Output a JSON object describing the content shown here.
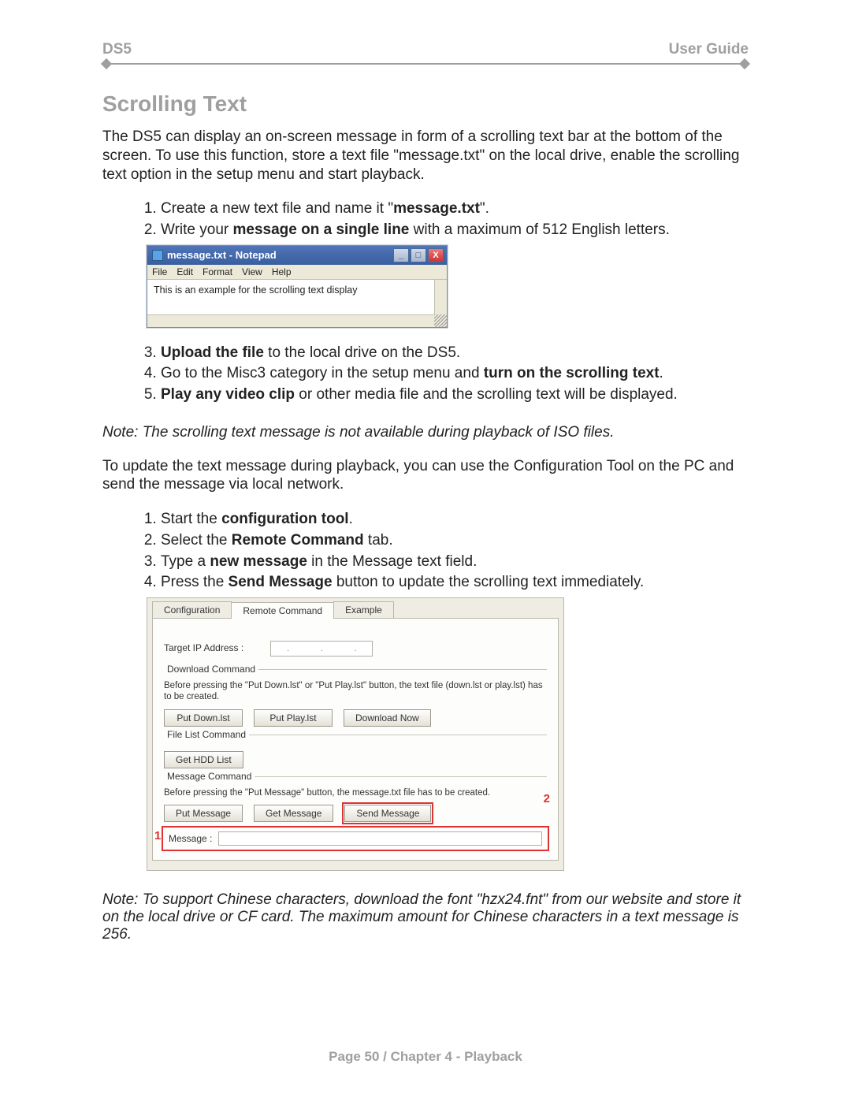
{
  "header": {
    "left": "DS5",
    "right": "User Guide"
  },
  "title": "Scrolling Text",
  "intro": "The DS5 can display an on-screen message in form of a scrolling text bar at the bottom of the screen. To use this function, store a text file \"message.txt\" on the local drive, enable the scrolling text option in the setup menu and start playback.",
  "steps_a": {
    "s1_pre": "Create a new text file and name it \"",
    "s1_bold": "message.txt",
    "s1_post": "\".",
    "s2_pre": "Write your ",
    "s2_bold": "message on a single line",
    "s2_post": " with a maximum of 512 English letters."
  },
  "notepad": {
    "title": "message.txt - Notepad",
    "menu": [
      "File",
      "Edit",
      "Format",
      "View",
      "Help"
    ],
    "content": "This is an example for the scrolling text display"
  },
  "steps_b": {
    "s3_bold": "Upload the file",
    "s3_post": " to the local drive on the DS5.",
    "s4_pre": "Go to the Misc3 category in the setup menu and ",
    "s4_bold": "turn on the scrolling text",
    "s4_post": ".",
    "s5_bold": "Play any video clip",
    "s5_post": " or other media file and the scrolling text will be displayed."
  },
  "note1": "Note: The scrolling text message is not available during playback of ISO files.",
  "update_intro": "To update the text message during playback, you can use the Configuration Tool on the PC and send the message via local network.",
  "steps_c": {
    "s1_pre": "Start the ",
    "s1_bold": "configuration tool",
    "s1_post": ".",
    "s2_pre": "Select the ",
    "s2_bold": "Remote Command",
    "s2_post": " tab.",
    "s3_pre": "Type a ",
    "s3_bold": "new message",
    "s3_post": " in the Message text field.",
    "s4_pre": "Press the ",
    "s4_bold": "Send Message",
    "s4_post": " button to update the scrolling text immediately."
  },
  "configtool": {
    "tabs": [
      "Configuration",
      "Remote Command",
      "Example"
    ],
    "target_ip_label": "Target IP Address :",
    "ip_dots": [
      ".",
      ".",
      "."
    ],
    "group_download": "Download Command",
    "download_desc": "Before pressing the \"Put Down.lst\" or \"Put Play.lst\" button, the text file (down.lst or play.lst) has to be created.",
    "btn_putdown": "Put Down.lst",
    "btn_putplay": "Put Play.lst",
    "btn_downloadnow": "Download Now",
    "group_filelist": "File List Command",
    "btn_gethdd": "Get HDD List",
    "group_message": "Message Command",
    "message_desc": "Before pressing the \"Put Message\" button, the message.txt file has to be created.",
    "btn_putmsg": "Put Message",
    "btn_getmsg": "Get Message",
    "btn_sendmsg": "Send Message",
    "msg_label": "Message :",
    "callout1": "1",
    "callout2": "2"
  },
  "note2": "Note: To support Chinese characters, download the font \"hzx24.fnt\" from our website and store it on the local drive or CF card. The maximum amount for Chinese characters in a text message is 256.",
  "footer": "Page 50  /  Chapter 4 - Playback"
}
